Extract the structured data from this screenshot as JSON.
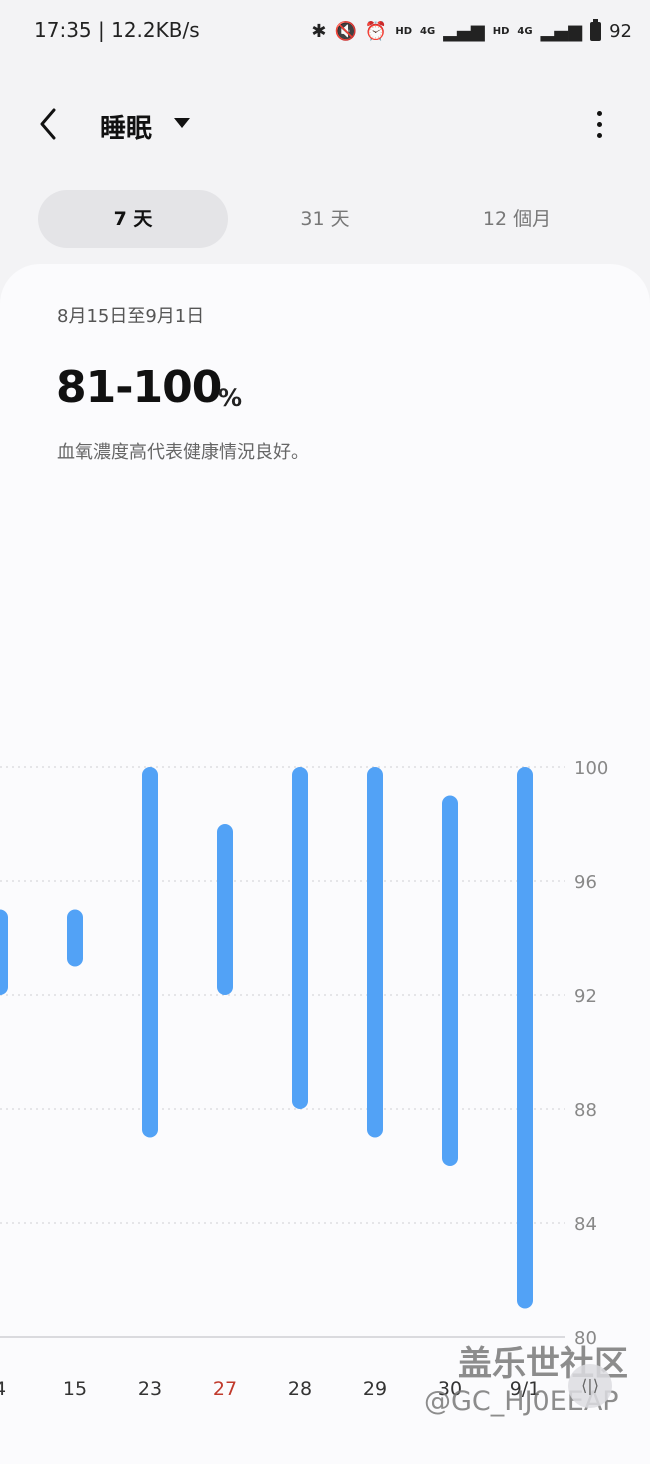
{
  "status_bar": {
    "time_speed": "17:35 | 12.2KB/s",
    "hd1": "HD",
    "net1": "4G",
    "hd2": "HD",
    "net2": "4G",
    "battery": "92"
  },
  "header": {
    "title": "睡眠"
  },
  "tabs": [
    {
      "label": "7 天",
      "active": true
    },
    {
      "label": "31 天",
      "active": false
    },
    {
      "label": "12 個月",
      "active": false
    }
  ],
  "summary": {
    "date_range": "8月15日至9月1日",
    "range_value": "81-100",
    "range_unit": "%",
    "description": "血氧濃度高代表健康情況良好。"
  },
  "chart_data": {
    "type": "bar",
    "categories": [
      "4",
      "15",
      "23",
      "27",
      "28",
      "29",
      "30",
      "9/1"
    ],
    "highlight_category": "27",
    "series": [
      {
        "low": [
          92,
          93,
          87,
          92,
          88,
          87,
          86,
          81
        ],
        "high": [
          95,
          95,
          100,
          98,
          100,
          100,
          99,
          100
        ]
      }
    ],
    "ylim": [
      80,
      100
    ],
    "yticks": [
      100,
      96,
      92,
      88,
      84,
      80
    ],
    "grid": true,
    "colors": {
      "bar": "#52a2f6",
      "highlight_label": "#c0392b",
      "label": "#333333",
      "grid": "#cfcfd4"
    }
  },
  "watermark": {
    "line1": "盖乐世社区",
    "line2": "@GC_HJ0EEAP"
  },
  "scroll_handle": {
    "icon": "⟨|⟩"
  }
}
